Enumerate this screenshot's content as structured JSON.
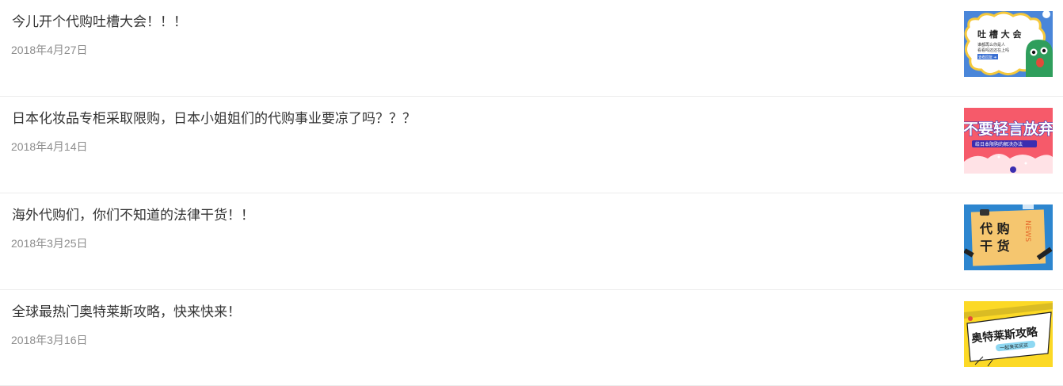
{
  "articles": [
    {
      "title": "今儿开个代购吐槽大会！！！",
      "date": "2018年4月27日",
      "thumbnail": {
        "text": "吐 槽 大 会",
        "subtext_lines": [
          "谁都再么你是人",
          "看看吗还还在上吗"
        ],
        "tag": "查看回复 ➜",
        "colors": {
          "bg": "#4a86d9",
          "cloud": "#ffffff",
          "outline": "#f6c93b",
          "monster": "#2f9e5c",
          "mouth": "#e34a3a"
        }
      }
    },
    {
      "title": "日本化妆品专柜采取限购，日本小姐姐们的代购事业要凉了吗？？？",
      "date": "2018年4月14日",
      "thumbnail": {
        "text": "不要轻言放弃",
        "subtext": "给日本限购的解决办法",
        "colors": {
          "bg": "#f65a6a",
          "text": "#ffffff",
          "outline": "#3a2db0",
          "band": "#3a2db0",
          "cloud": "#ffe2e6"
        }
      }
    },
    {
      "title": "海外代购们，你们不知道的法律干货！！",
      "date": "2018年3月25日",
      "thumbnail": {
        "text_line1": "代 购",
        "text_line2": "干 货",
        "side_text": "NEWS",
        "colors": {
          "bg": "#2d86cf",
          "paper": "#f5c66f",
          "text": "#1c1c1c",
          "side": "#e66a2c"
        }
      }
    },
    {
      "title": "全球最热门奥特莱斯攻略，快来快来！",
      "date": "2018年3月16日",
      "thumbnail": {
        "text": "奥特莱斯攻略",
        "subtext": "一起来买买买",
        "colors": {
          "bg": "#fcd926",
          "paper": "#ffffff",
          "text": "#1e1e1e",
          "band": "#8ed8f2",
          "accent": "#e64a3b"
        }
      }
    }
  ]
}
